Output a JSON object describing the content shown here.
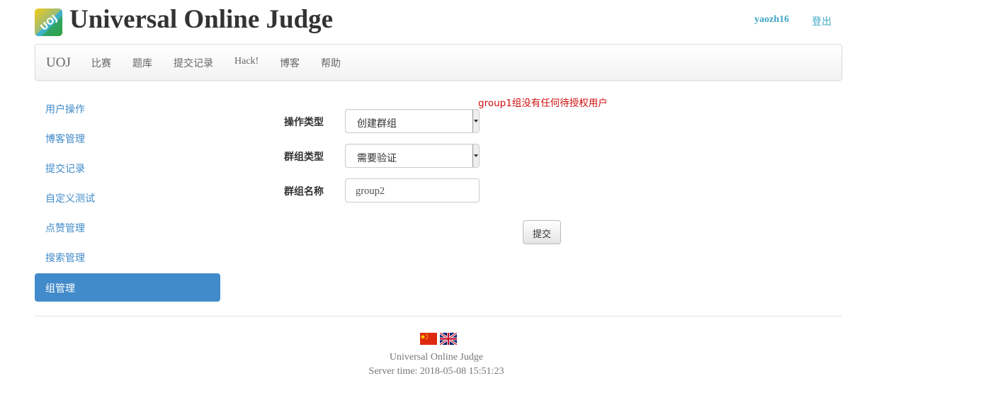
{
  "header": {
    "logo_text": "UOJ",
    "site_title": "Universal Online Judge",
    "username": "yaozh16",
    "logout_label": "登出"
  },
  "navbar": {
    "brand": "UOJ",
    "items": [
      "比赛",
      "题库",
      "提交记录",
      "Hack!",
      "博客",
      "帮助"
    ]
  },
  "sidebar": {
    "items": [
      {
        "label": "用户操作",
        "active": false
      },
      {
        "label": "博客管理",
        "active": false
      },
      {
        "label": "提交记录",
        "active": false
      },
      {
        "label": "自定义测试",
        "active": false
      },
      {
        "label": "点赞管理",
        "active": false
      },
      {
        "label": "搜索管理",
        "active": false
      },
      {
        "label": "组管理",
        "active": true
      }
    ]
  },
  "form": {
    "warning": "group1组没有任何待授权用户",
    "operation_type_label": "操作类型",
    "operation_type_value": "创建群组",
    "group_type_label": "群组类型",
    "group_type_value": "需要验证",
    "group_name_label": "群组名称",
    "group_name_value": "group2",
    "submit_label": "提交"
  },
  "footer": {
    "site_name": "Universal Online Judge",
    "server_time": "Server time: 2018-05-08 15:51:23"
  },
  "colors": {
    "link": "#428bca",
    "active_bg": "#428bca",
    "warning": "#d01010",
    "user_link": "#3fa7c6"
  },
  "icons": {
    "logo": "uoj-logo-icon",
    "flag_cn": "china-flag-icon",
    "flag_en": "uk-flag-icon"
  }
}
